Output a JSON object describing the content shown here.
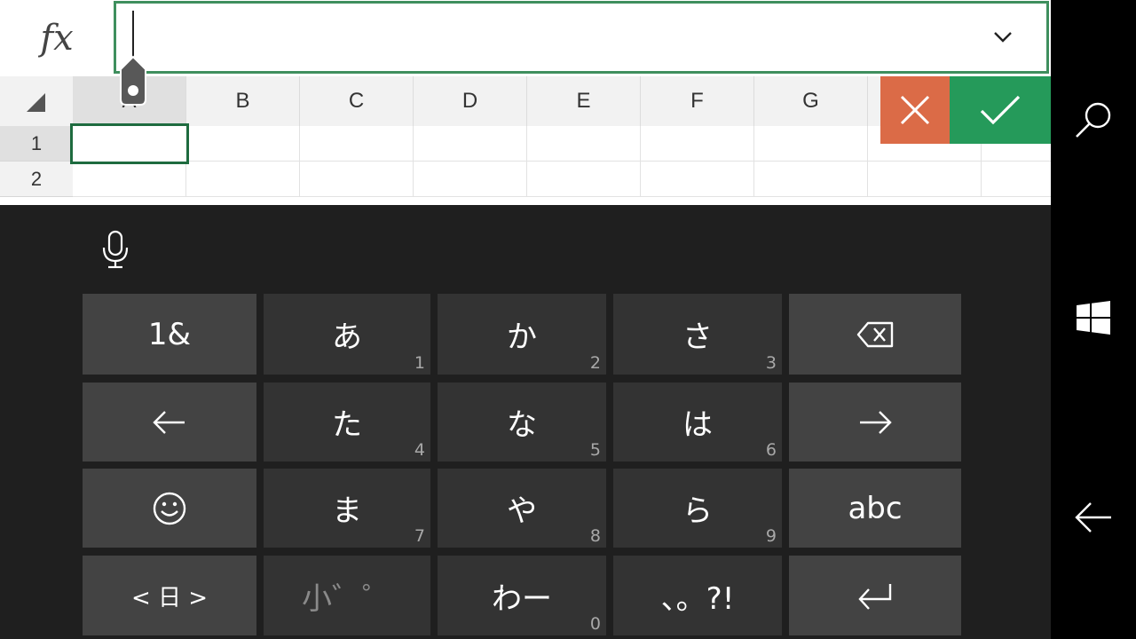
{
  "formula_bar": {
    "fx_label": "fx",
    "value": ""
  },
  "columns": [
    "A",
    "B",
    "C",
    "D",
    "E",
    "F",
    "G"
  ],
  "rows": [
    "1",
    "2"
  ],
  "keyboard": {
    "row1": [
      {
        "label": "1&",
        "sub": ""
      },
      {
        "label": "あ",
        "sub": "1"
      },
      {
        "label": "か",
        "sub": "2"
      },
      {
        "label": "さ",
        "sub": "3"
      }
    ],
    "row2": [
      {
        "label": "た",
        "sub": "4"
      },
      {
        "label": "な",
        "sub": "5"
      },
      {
        "label": "は",
        "sub": "6"
      }
    ],
    "row3": [
      {
        "label": "ま",
        "sub": "7"
      },
      {
        "label": "や",
        "sub": "8"
      },
      {
        "label": "ら",
        "sub": "9"
      },
      {
        "label": "abc",
        "sub": ""
      }
    ],
    "row4": [
      {
        "label": "< 日 >",
        "sub": ""
      },
      {
        "label": "小゛゜",
        "sub": ""
      },
      {
        "label": "わー",
        "sub": "0"
      },
      {
        "label": "、。?!",
        "sub": ""
      }
    ]
  },
  "colors": {
    "accent_green": "#259a5a",
    "cancel_orange": "#db6b47",
    "keyboard_bg": "#1f1f1f"
  },
  "icons": [
    "chevron-down-icon",
    "selection-handle-icon",
    "select-all-icon",
    "cancel-icon",
    "checkmark-icon",
    "microphone-icon",
    "backspace-icon",
    "arrow-left-icon",
    "arrow-right-icon",
    "emoji-icon",
    "enter-icon",
    "search-icon",
    "windows-logo-icon",
    "back-arrow-icon"
  ]
}
